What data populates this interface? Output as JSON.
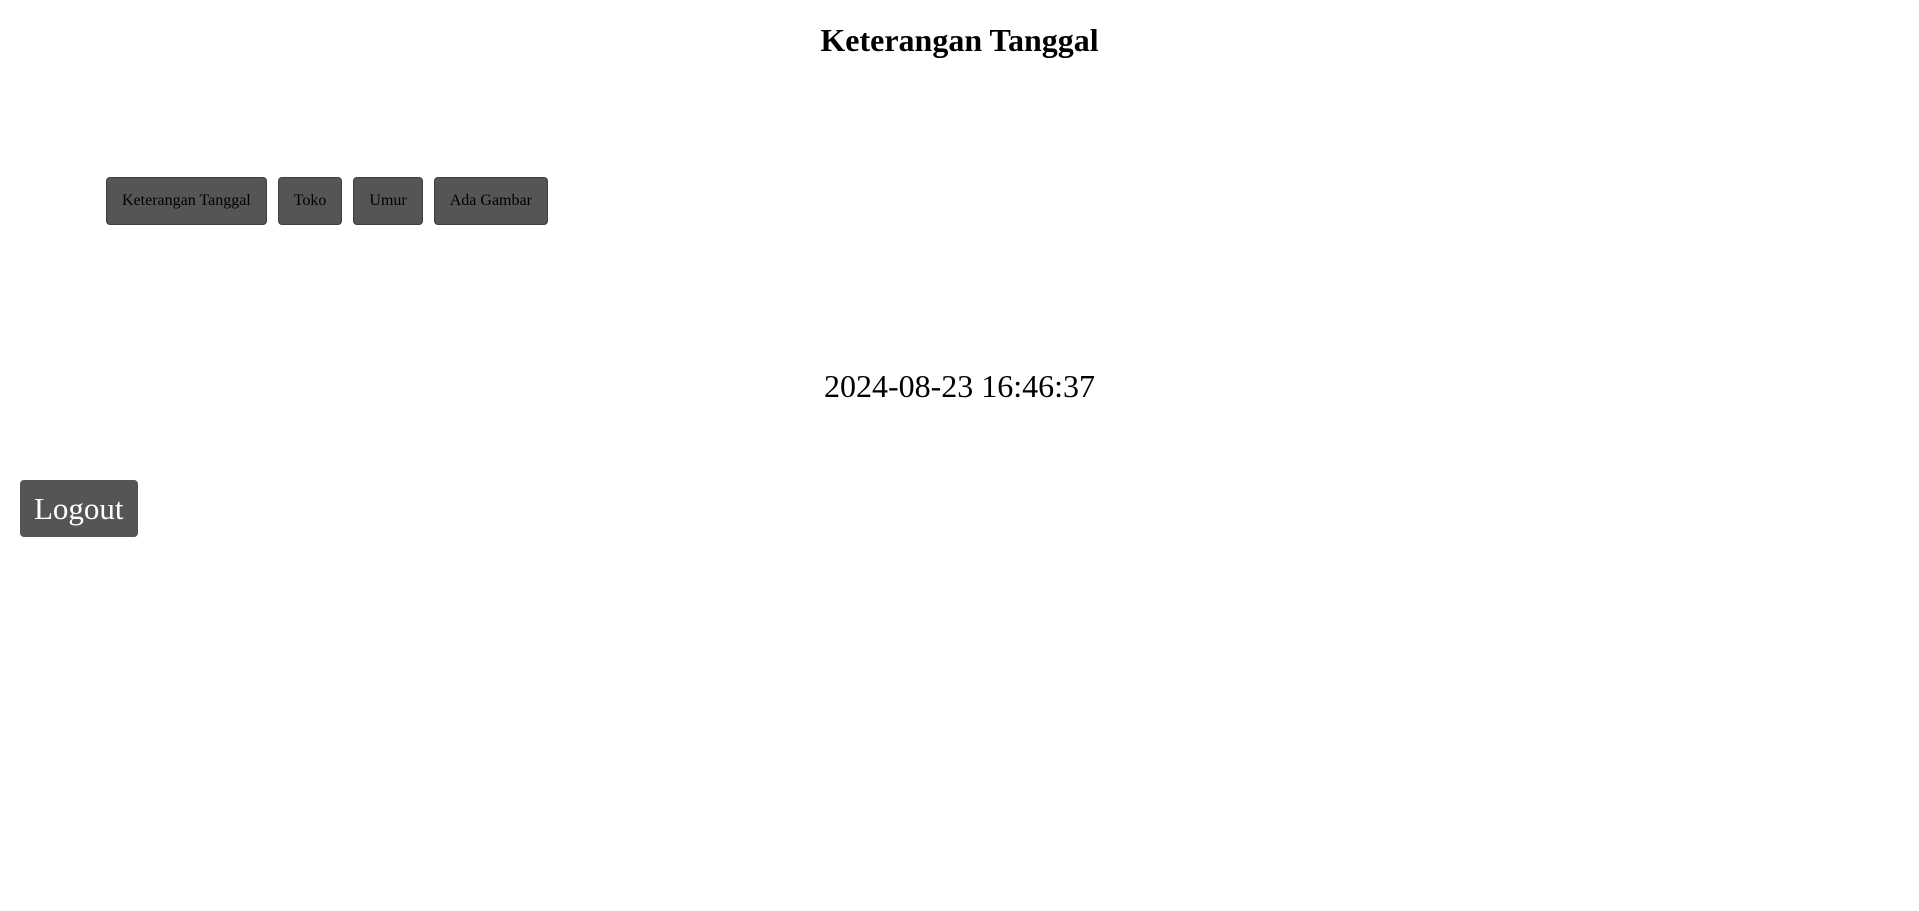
{
  "header": {
    "title": "Keterangan Tanggal"
  },
  "nav": {
    "items": [
      {
        "label": "Keterangan Tanggal"
      },
      {
        "label": "Toko"
      },
      {
        "label": "Umur"
      },
      {
        "label": "Ada Gambar"
      }
    ]
  },
  "main": {
    "datetime": "2024-08-23 16:46:37"
  },
  "footer": {
    "logout_label": "Logout"
  },
  "colors": {
    "button_bg": "#555555",
    "page_bg": "#ffffff"
  }
}
